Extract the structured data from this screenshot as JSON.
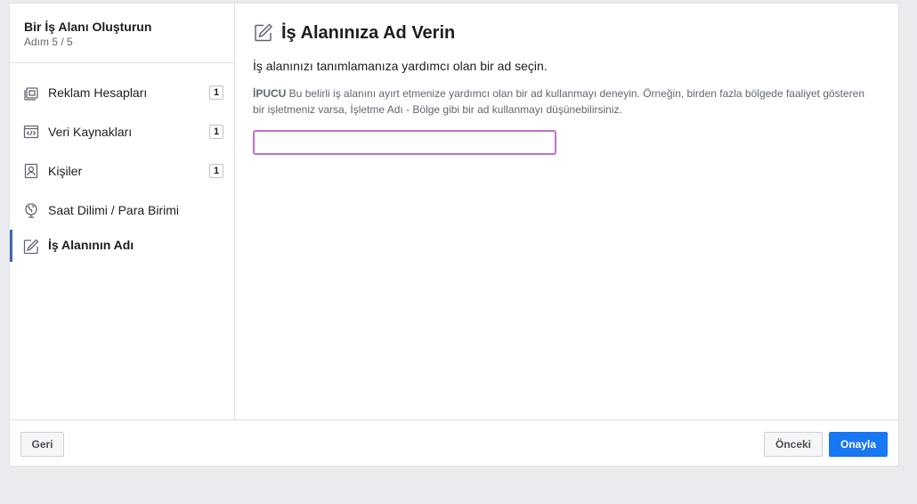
{
  "sidebar": {
    "title": "Bir İş Alanı Oluşturun",
    "step_text": "Adım 5 / 5",
    "items": [
      {
        "label": "Reklam Hesapları",
        "count": "1",
        "icon": "ad-accounts-icon"
      },
      {
        "label": "Veri Kaynakları",
        "count": "1",
        "icon": "data-sources-icon"
      },
      {
        "label": "Kişiler",
        "count": "1",
        "icon": "people-icon"
      },
      {
        "label": "Saat Dilimi / Para Birimi",
        "icon": "globe-icon"
      },
      {
        "label": "İş Alanının Adı",
        "icon": "pencil-icon",
        "active": true
      }
    ]
  },
  "main": {
    "title": "İş Alanınıza Ad Verin",
    "description": "İş alanınızı tanımlamanıza yardımcı olan bir ad seçin.",
    "tip_label": "İPUCU",
    "tip_text": " Bu belirli iş alanını ayırt etmenize yardımcı olan bir ad kullanmayı deneyin. Örneğin, birden fazla bölgede faaliyet gösteren bir işletmeniz varsa, İşletme Adı - Bölge gibi bir ad kullanmayı düşünebilirsiniz.",
    "input_value": ""
  },
  "footer": {
    "back_label": "Geri",
    "previous_label": "Önceki",
    "confirm_label": "Onayla"
  },
  "colors": {
    "accent": "#4267b2",
    "primary_button": "#1877f2",
    "input_focus_border": "#c36fd1"
  }
}
